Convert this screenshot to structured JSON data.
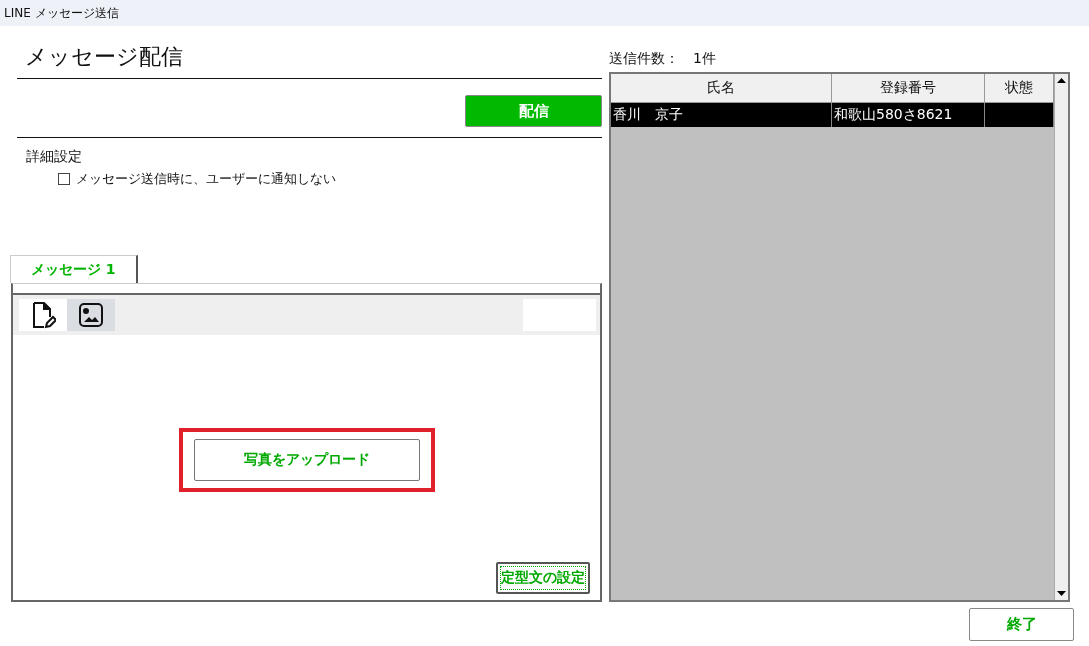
{
  "window": {
    "title": "LINE メッセージ送信"
  },
  "heading": "メッセージ配信",
  "send_button": "配信",
  "details": {
    "label": "詳細設定",
    "checkbox": {
      "label": "メッセージ送信時に、ユーザーに通知しない",
      "checked": false
    }
  },
  "tabs": [
    {
      "label": "メッセージ 1",
      "selected": true
    }
  ],
  "editor_modes": [
    {
      "kind": "text",
      "selected": false
    },
    {
      "kind": "image",
      "selected": true
    }
  ],
  "upload_button": "写真をアップロード",
  "template_button": "定型文の設定",
  "count": {
    "label": "送信件数：",
    "value": "1件"
  },
  "table": {
    "columns": [
      "氏名",
      "登録番号",
      "状態"
    ],
    "rows": [
      {
        "cells": [
          "香川　京子",
          "和歌山580さ8621"
        ],
        "selected": true
      }
    ]
  },
  "exit_button": "終了"
}
